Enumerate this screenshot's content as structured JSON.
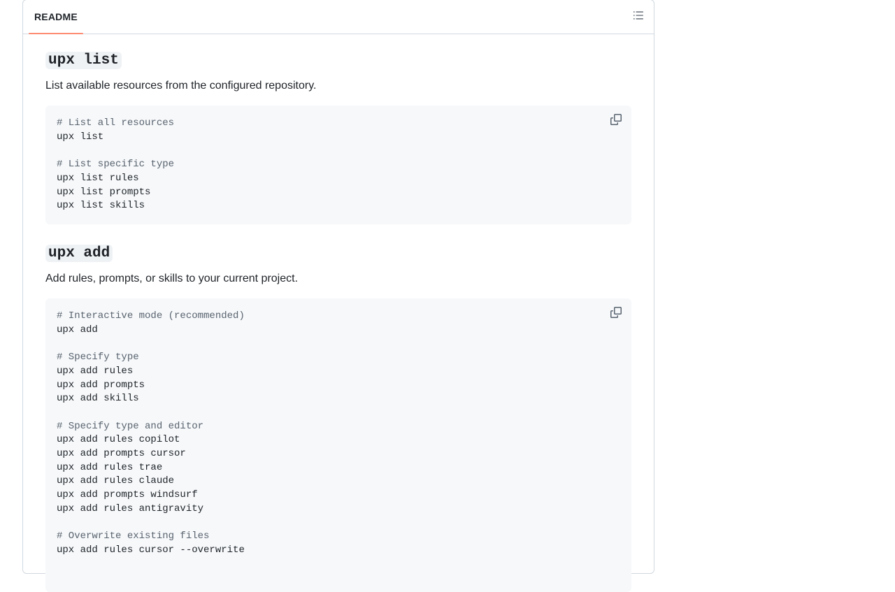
{
  "readme": {
    "tab_label": "README",
    "outline_icon": "list-unordered-icon"
  },
  "sections": [
    {
      "command": "upx list",
      "description": "List available resources from the configured repository.",
      "copy_icon": "copy-icon",
      "code_lines": [
        "# List all resources",
        "upx list",
        "",
        "# List specific type",
        "upx list rules",
        "upx list prompts",
        "upx list skills"
      ]
    },
    {
      "command": "upx add",
      "description": "Add rules, prompts, or skills to your current project.",
      "copy_icon": "copy-icon",
      "code_lines": [
        "# Interactive mode (recommended)",
        "upx add",
        "",
        "# Specify type",
        "upx add rules",
        "upx add prompts",
        "upx add skills",
        "",
        "# Specify type and editor",
        "upx add rules copilot",
        "upx add prompts cursor",
        "upx add rules trae",
        "upx add rules claude",
        "upx add prompts windsurf",
        "upx add rules antigravity",
        "",
        "# Overwrite existing files",
        "upx add rules cursor --overwrite"
      ]
    }
  ]
}
